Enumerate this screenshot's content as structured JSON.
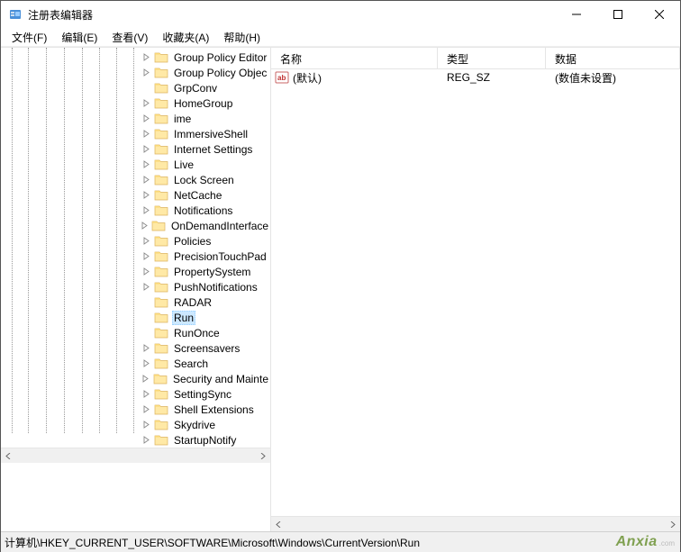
{
  "window": {
    "title": "注册表编辑器"
  },
  "menu": {
    "file": "文件(F)",
    "edit": "编辑(E)",
    "view": "查看(V)",
    "favorites": "收藏夹(A)",
    "help": "帮助(H)"
  },
  "tree": {
    "nodes": [
      {
        "label": "Group Policy Editor",
        "expandable": true
      },
      {
        "label": "Group Policy Objec",
        "expandable": true
      },
      {
        "label": "GrpConv",
        "expandable": false
      },
      {
        "label": "HomeGroup",
        "expandable": true
      },
      {
        "label": "ime",
        "expandable": true
      },
      {
        "label": "ImmersiveShell",
        "expandable": true
      },
      {
        "label": "Internet Settings",
        "expandable": true
      },
      {
        "label": "Live",
        "expandable": true
      },
      {
        "label": "Lock Screen",
        "expandable": true
      },
      {
        "label": "NetCache",
        "expandable": true
      },
      {
        "label": "Notifications",
        "expandable": true
      },
      {
        "label": "OnDemandInterface",
        "expandable": true
      },
      {
        "label": "Policies",
        "expandable": true
      },
      {
        "label": "PrecisionTouchPad",
        "expandable": true
      },
      {
        "label": "PropertySystem",
        "expandable": true
      },
      {
        "label": "PushNotifications",
        "expandable": true
      },
      {
        "label": "RADAR",
        "expandable": false
      },
      {
        "label": "Run",
        "expandable": false,
        "selected": true
      },
      {
        "label": "RunOnce",
        "expandable": false
      },
      {
        "label": "Screensavers",
        "expandable": true
      },
      {
        "label": "Search",
        "expandable": true
      },
      {
        "label": "Security and Mainte",
        "expandable": true
      },
      {
        "label": "SettingSync",
        "expandable": true
      },
      {
        "label": "Shell Extensions",
        "expandable": true
      },
      {
        "label": "Skydrive",
        "expandable": true
      },
      {
        "label": "StartupNotify",
        "expandable": true
      }
    ]
  },
  "columns": {
    "name": "名称",
    "type": "类型",
    "data": "数据"
  },
  "values": [
    {
      "name": "(默认)",
      "type": "REG_SZ",
      "data": "(数值未设置)"
    }
  ],
  "status": "计算机\\HKEY_CURRENT_USER\\SOFTWARE\\Microsoft\\Windows\\CurrentVersion\\Run",
  "watermark": {
    "main": "Anxia",
    "sub": ".com"
  }
}
